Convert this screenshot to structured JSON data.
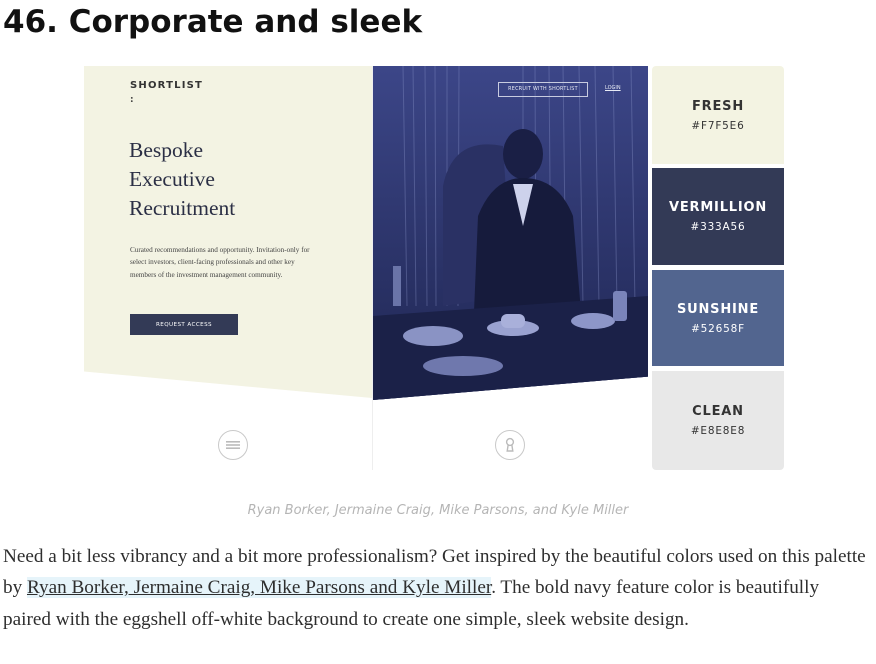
{
  "heading": "46. Corporate and sleek",
  "mockup": {
    "brand": "SHORTLIST",
    "brand_colon": ":",
    "headline_lines": [
      "Bespoke",
      "Executive",
      "Recruitment"
    ],
    "blurb": "Curated recommendations and opportunity. Invitation-only for select investors, client-facing professionals and other key members of the investment management community.",
    "request_button": "REQUEST ACCESS",
    "nav_button": "RECRUIT WITH SHORTLIST",
    "login": "LOGIN"
  },
  "swatches": [
    {
      "name": "FRESH",
      "hex": "#F7F5E6",
      "color": "#f3f3e2"
    },
    {
      "name": "VERMILLION",
      "hex": "#333A56",
      "color": "#333a56"
    },
    {
      "name": "SUNSHINE",
      "hex": "#52658F",
      "color": "#52658f"
    },
    {
      "name": "CLEAN",
      "hex": "#E8E8E8",
      "color": "#e8e8e8"
    }
  ],
  "caption": "Ryan Borker, Jermaine Craig, Mike Parsons, and Kyle Miller",
  "paragraph": {
    "before": "Need a bit less vibrancy and a bit more professionalism? Get inspired by the beautiful colors used on this palette by ",
    "link": "Ryan Borker, Jermaine Craig, Mike Parsons and Kyle Miller",
    "after": ". The bold navy feature color is beautifully paired with the eggshell off-white background to create one simple, sleek website design."
  },
  "icons": [
    "menu-icon",
    "keyhole-icon"
  ]
}
